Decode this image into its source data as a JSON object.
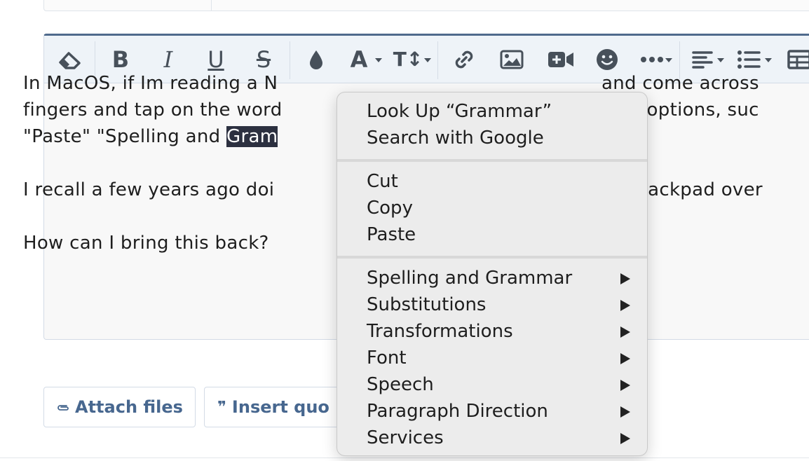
{
  "toolbar": {
    "buttons": [
      {
        "name": "remove-format",
        "icon": "eraser-icon"
      },
      {
        "name": "bold",
        "icon": "bold-icon",
        "glyph": "B"
      },
      {
        "name": "italic",
        "icon": "italic-icon",
        "glyph": "I"
      },
      {
        "name": "underline",
        "icon": "underline-icon",
        "glyph": "U"
      },
      {
        "name": "strikethrough",
        "icon": "strikethrough-icon",
        "glyph": "S"
      },
      {
        "name": "text-color",
        "icon": "droplet-icon"
      },
      {
        "name": "font-family",
        "icon": "font-icon",
        "glyph": "A"
      },
      {
        "name": "font-size",
        "icon": "text-size-icon",
        "glyph": "T↕"
      },
      {
        "name": "insert-link",
        "icon": "link-icon"
      },
      {
        "name": "insert-image",
        "icon": "image-icon"
      },
      {
        "name": "insert-video",
        "icon": "video-icon"
      },
      {
        "name": "insert-smilie",
        "icon": "smiley-icon"
      },
      {
        "name": "more-options",
        "icon": "ellipsis-icon"
      },
      {
        "name": "alignment",
        "icon": "align-left-icon"
      },
      {
        "name": "list",
        "icon": "list-icon"
      },
      {
        "name": "insert-table",
        "icon": "table-icon"
      }
    ]
  },
  "content": {
    "line1": "In MacOS, if Im reading a N",
    "line1b": "and come across",
    "line2": "fingers and tap on the word",
    "line2b": "s up options, suc",
    "line3a": "\"Paste\" \"Spelling and ",
    "line3sel": "Gram",
    "line4": "I recall a few years ago doi",
    "line4b": "he trackpad over",
    "line5": "How can I bring this back?"
  },
  "buttons": {
    "attach_label": "Attach files",
    "quote_label": "Insert quo"
  },
  "context_menu": {
    "group1": [
      "Look Up “Grammar”",
      "Search with Google"
    ],
    "group2": [
      "Cut",
      "Copy",
      "Paste"
    ],
    "group3": [
      "Spelling and Grammar",
      "Substitutions",
      "Transformations",
      "Font",
      "Speech",
      "Paragraph Direction",
      "Services"
    ]
  },
  "colors": {
    "accent": "#4f6a8c",
    "link": "#47678f",
    "selection": "#2c3040"
  }
}
